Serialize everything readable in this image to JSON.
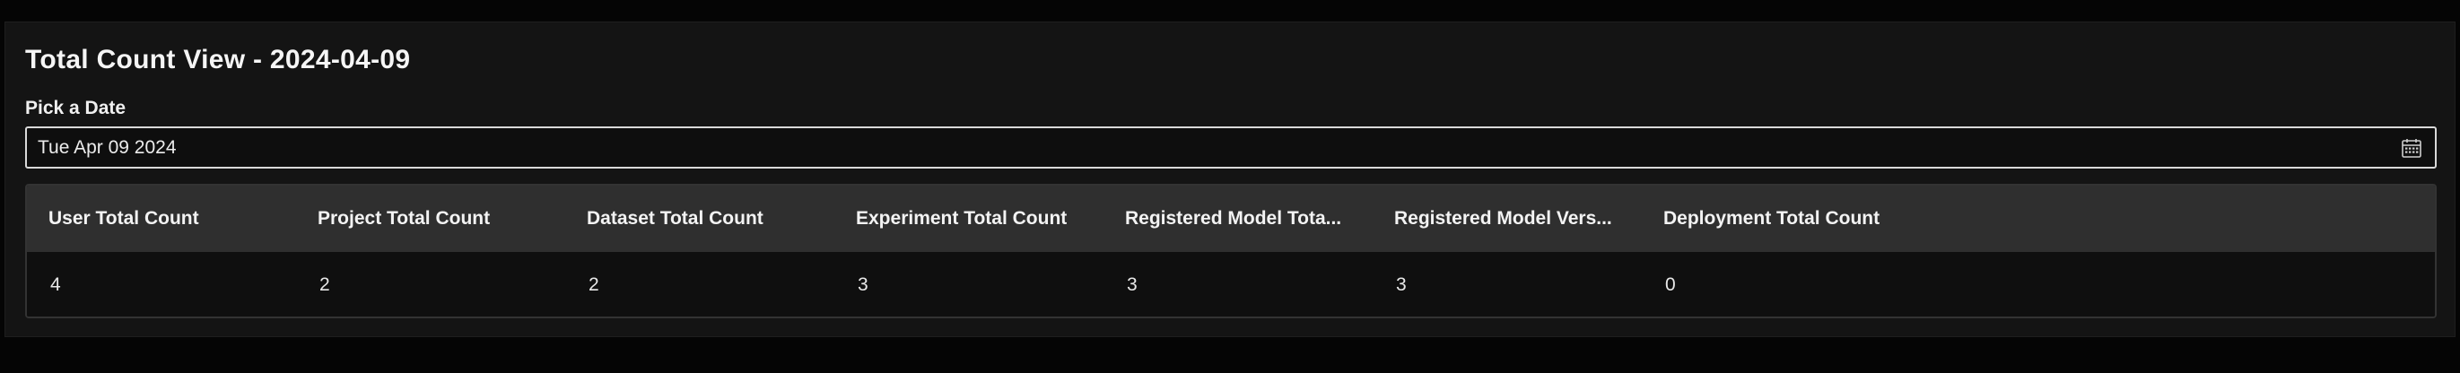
{
  "view": {
    "title": "Total Count View - 2024-04-09"
  },
  "date_picker": {
    "label": "Pick a Date",
    "value": "Tue Apr 09 2024",
    "icon": "calendar-icon"
  },
  "table": {
    "columns": [
      "User Total Count",
      "Project Total Count",
      "Dataset Total Count",
      "Experiment Total Count",
      "Registered Model Tota...",
      "Registered Model Vers...",
      "Deployment Total Count"
    ],
    "rows": [
      [
        "4",
        "2",
        "2",
        "3",
        "3",
        "3",
        "0"
      ]
    ]
  },
  "colors": {
    "background": "#050505",
    "panel": "#141414",
    "header_row": "#2f2f2f",
    "text": "#f2f2f2"
  }
}
